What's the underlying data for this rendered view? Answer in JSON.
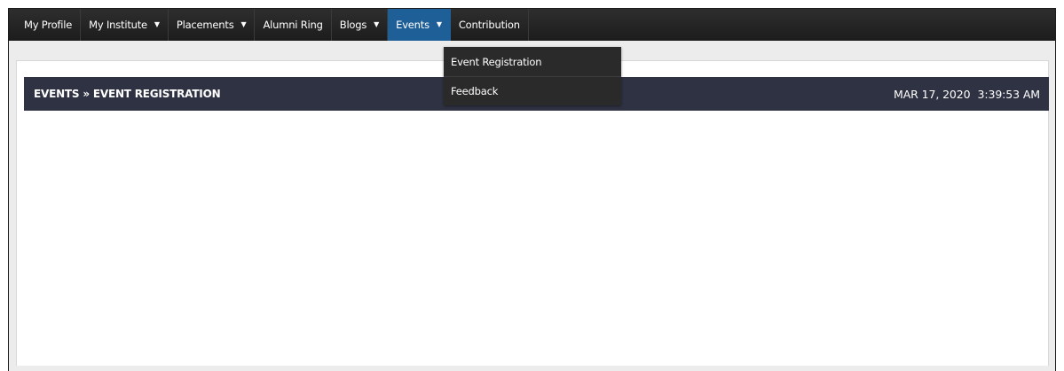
{
  "navbar": {
    "items": [
      {
        "label": "My Profile",
        "has_menu": false
      },
      {
        "label": "My Institute",
        "has_menu": true
      },
      {
        "label": "Placements",
        "has_menu": true
      },
      {
        "label": "Alumni Ring",
        "has_menu": false
      },
      {
        "label": "Blogs",
        "has_menu": true
      },
      {
        "label": "Events",
        "has_menu": true,
        "active": true
      },
      {
        "label": "Contribution",
        "has_menu": false
      }
    ],
    "caret_glyph": "▼"
  },
  "events_menu": {
    "items": [
      "Event Registration",
      "Feedback"
    ]
  },
  "header": {
    "breadcrumb": "EVENTS » EVENT REGISTRATION",
    "date": "MAR 17, 2020",
    "time": "3:39:53 AM"
  },
  "colors": {
    "navbar_bg": "#1c1c1c",
    "active_tab": "#1f5f97",
    "header_bg": "#2f3242",
    "dropdown_bg": "#2a2a2a",
    "page_bg": "#ececec"
  }
}
